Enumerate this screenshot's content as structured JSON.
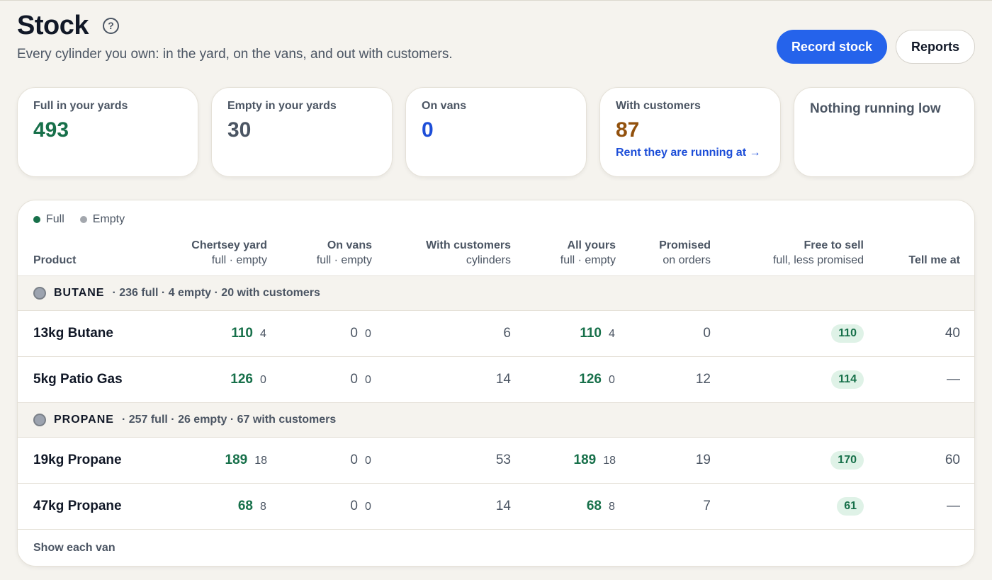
{
  "header": {
    "title": "Stock",
    "subtitle": "Every cylinder you own: in the yard, on the vans, and out with customers.",
    "help_icon": "question-circle-icon",
    "record_stock_label": "Record stock",
    "reports_label": "Reports"
  },
  "stats": {
    "full": {
      "label": "Full in your yards",
      "value": "493"
    },
    "empty": {
      "label": "Empty in your yards",
      "value": "30"
    },
    "vans": {
      "label": "On vans",
      "value": "0"
    },
    "customers": {
      "label": "With customers",
      "value": "87",
      "link": "Rent they are running at →"
    },
    "low": {
      "label": "Nothing running low"
    }
  },
  "colors": {
    "full": "#17704a",
    "empty": "#a3a7ad",
    "accent": "#2563eb",
    "customers": "#92510d",
    "vans": "#1d4ed8"
  },
  "legend": {
    "full": "Full",
    "empty": "Empty"
  },
  "columns": {
    "product": "Product",
    "yard": {
      "title": "Chertsey yard",
      "sub": "full · empty"
    },
    "vans": {
      "title": "On vans",
      "sub": "full · empty"
    },
    "customers": {
      "title": "With customers",
      "sub": "cylinders"
    },
    "all": {
      "title": "All yours",
      "sub": "full · empty"
    },
    "promised": {
      "title": "Promised",
      "sub": "on orders"
    },
    "free": {
      "title": "Free to sell",
      "sub": "full, less promised"
    },
    "tell": {
      "title": "Tell me at"
    }
  },
  "groups": [
    {
      "name": "BUTANE",
      "summary": "· 236 full · 4 empty · 20 with customers",
      "rows": [
        {
          "product": "13kg Butane",
          "yard_full": "110",
          "yard_empty": "4",
          "vans_full": "0",
          "vans_empty": "0",
          "customers": "6",
          "all_full": "110",
          "all_empty": "4",
          "promised": "0",
          "free": "110",
          "tell": "40"
        },
        {
          "product": "5kg Patio Gas",
          "yard_full": "126",
          "yard_empty": "0",
          "vans_full": "0",
          "vans_empty": "0",
          "customers": "14",
          "all_full": "126",
          "all_empty": "0",
          "promised": "12",
          "free": "114",
          "tell": "—"
        }
      ]
    },
    {
      "name": "PROPANE",
      "summary": "· 257 full · 26 empty · 67 with customers",
      "rows": [
        {
          "product": "19kg Propane",
          "yard_full": "189",
          "yard_empty": "18",
          "vans_full": "0",
          "vans_empty": "0",
          "customers": "53",
          "all_full": "189",
          "all_empty": "18",
          "promised": "19",
          "free": "170",
          "tell": "60"
        },
        {
          "product": "47kg Propane",
          "yard_full": "68",
          "yard_empty": "8",
          "vans_full": "0",
          "vans_empty": "0",
          "customers": "14",
          "all_full": "68",
          "all_empty": "8",
          "promised": "7",
          "free": "61",
          "tell": "—"
        }
      ]
    }
  ],
  "footer": {
    "show_vans": "Show each van"
  }
}
